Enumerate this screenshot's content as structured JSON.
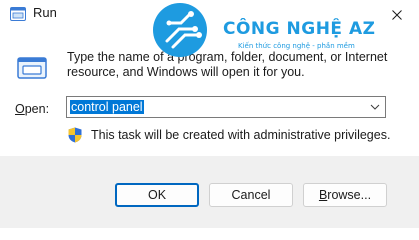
{
  "window": {
    "title": "Run",
    "close_icon": "close-icon"
  },
  "dialog": {
    "description": "Type the name of a program, folder, document, or Internet resource, and Windows will open it for you.",
    "open_label_accel": "O",
    "open_label_rest": "pen:",
    "open_value": "control panel",
    "admin_note": "This task will be created with administrative privileges."
  },
  "buttons": {
    "ok": "OK",
    "cancel": "Cancel",
    "browse_accel": "B",
    "browse_rest": "rowse..."
  },
  "watermark": {
    "name": "CÔNG NGHỆ AZ",
    "tagline": "Kiến thức công nghệ - phần mềm"
  },
  "colors": {
    "selection": "#0078d7",
    "footer_bg": "#f0f0f0",
    "ok_border": "#0067c0",
    "watermark": "#1e9be0"
  }
}
